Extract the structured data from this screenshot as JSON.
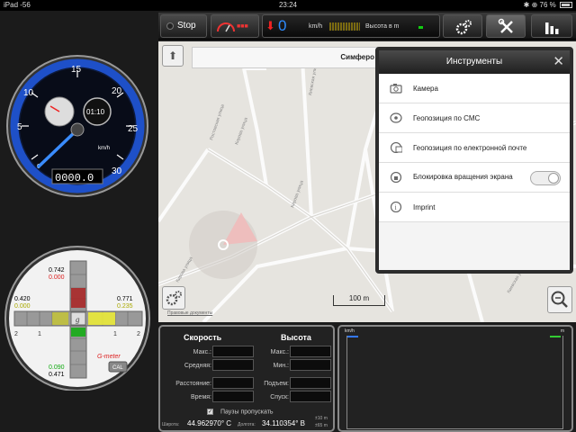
{
  "statusbar": {
    "device": "iPad",
    "signal": "-56",
    "time": "23:24",
    "battery": "76 %"
  },
  "toolbar": {
    "stop_label": "Stop",
    "speed_value": "0",
    "speed_unit": "km/h",
    "altitude_label": "Высота в m"
  },
  "map": {
    "search_text": "Симферо",
    "legal_label": "Правовые документы",
    "scale_label": "100 m",
    "streets": [
      "Кирова улица",
      "Ростовская улица",
      "Кирова улица",
      "Киевская улица",
      "Кирова улица",
      "Киевская улица"
    ]
  },
  "tools_popover": {
    "title": "Инструменты",
    "items": [
      {
        "label": "Камера",
        "icon": "camera-icon"
      },
      {
        "label": "Геопозиция по СМС",
        "icon": "sms-location-icon"
      },
      {
        "label": "Геопозиция по електронной почте",
        "icon": "email-location-icon"
      },
      {
        "label": "Блокировка вращения экрана",
        "icon": "rotation-lock-icon",
        "toggle": false
      },
      {
        "label": "Imprint",
        "icon": "info-icon"
      }
    ]
  },
  "speedometer": {
    "ticks": [
      "5",
      "10",
      "15",
      "20",
      "25",
      "30"
    ],
    "zero_mark": "0",
    "unit": "km/h",
    "clock": "01:10",
    "odometer": "0000.0"
  },
  "gmeter": {
    "top_black": "0.742",
    "top_red": "0.000",
    "left_black": "0.420",
    "left_yellow": "0.000",
    "right_black": "0.771",
    "right_yellow": "0.235",
    "bottom_green": "0.090",
    "bottom_black": "0.471",
    "center_label": "g",
    "title": "G-meter",
    "cal_label": "CAL",
    "scale_numbers": [
      "2",
      "1",
      "1",
      "2"
    ]
  },
  "stats": {
    "speed_header": "Скорость",
    "altitude_header": "Высота",
    "max_label": "Макс.:",
    "avg_label": "Средняя:",
    "alt_max_label": "Макс.:",
    "alt_min_label": "Мин.:",
    "distance_label": "Расстояние:",
    "time_label": "Время:",
    "ascent_label": "Подъем:",
    "descent_label": "Спуск:",
    "pause_label": "Паузы пропускать",
    "lat_label": "Широта:",
    "lat_value": "44.962970° С",
    "lon_label": "Долгота:",
    "lon_value": "34.110354° В",
    "accuracy_1": "±10 m",
    "accuracy_2": "±65 m"
  },
  "graph": {
    "left_unit": "km/h",
    "right_unit": "m"
  },
  "colors": {
    "speed_blue": "#2e8cff",
    "alert_red": "#e22222",
    "gauge_blue": "#1e50c8"
  }
}
